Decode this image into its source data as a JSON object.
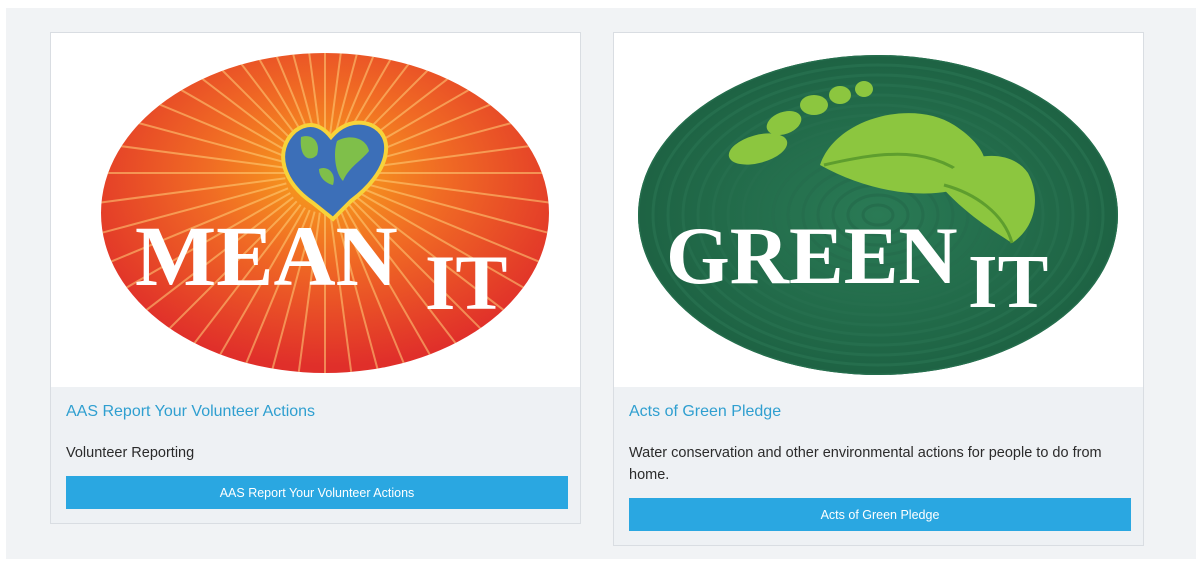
{
  "cards": [
    {
      "title": "AAS Report Your Volunteer Actions",
      "description": "Volunteer Reporting",
      "button_label": "AAS Report Your Volunteer Actions",
      "image": {
        "icon": "mean-it-heart-earth-logo",
        "text_main": "MEAN",
        "text_sub": "IT",
        "colors": {
          "fill": "#e8352a",
          "rays": "#f7a31c",
          "heart": "#3c6fb8",
          "land": "#7fbf4a"
        }
      }
    },
    {
      "title": "Acts of Green Pledge",
      "description": "Water conservation and other environmental actions for people to do from home.",
      "button_label": "Acts of Green Pledge",
      "image": {
        "icon": "green-it-leaf-footprint-logo",
        "text_main": "GREEN",
        "text_sub": "IT",
        "colors": {
          "fill": "#1f6b4a",
          "leaf": "#8cc63f",
          "leaf_dark": "#5e9e2e"
        }
      }
    }
  ],
  "colors": {
    "link": "#2f9fd0",
    "button": "#2aa7e1",
    "card_bg": "#eef1f4"
  }
}
